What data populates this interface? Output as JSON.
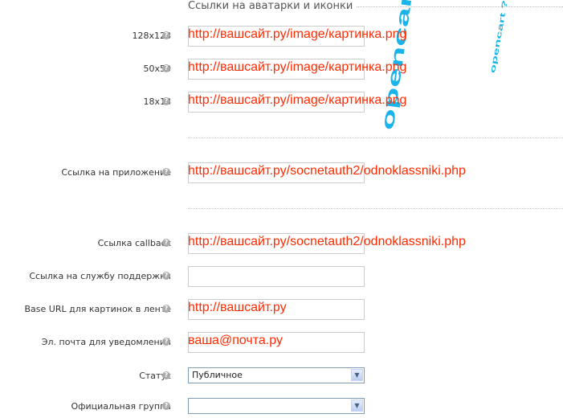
{
  "section_title": "Ссылки на аватарки и иконки",
  "watermark": "opencart",
  "rows": [
    {
      "label": "128x128",
      "value": "http://вашсайт.ру/image/картинка.png"
    },
    {
      "label": "50x50",
      "value": "http://вашсайт.ру/image/картинка.png"
    },
    {
      "label": "18x18",
      "value": "http://вашсайт.ру/image/картинка.png"
    },
    {
      "label": "Ссылка на приложение",
      "value": "http://вашсайт.ру/socnetauth2/odnoklassniki.php"
    },
    {
      "label": "Ссылка callback",
      "value": "http://вашсайт.ру/socnetauth2/odnoklassniki.php"
    },
    {
      "label": "Ссылка на службу поддержки",
      "value": ""
    },
    {
      "label": "Base URL для картинок в ленте",
      "value": "http://вашсайт.ру"
    },
    {
      "label": "Эл. почта для уведомлений",
      "value": "ваша@почта.ру"
    }
  ],
  "status": {
    "label": "Статус",
    "value": "Публичное"
  },
  "group": {
    "label": "Официальная группа",
    "value": ""
  },
  "help_glyph": "?",
  "arrow_glyph": "▼"
}
